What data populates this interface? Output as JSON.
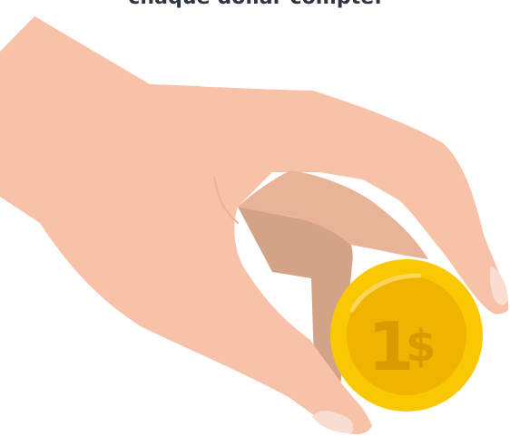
{
  "caption": {
    "text": "chaque dollar compte."
  },
  "coin": {
    "label_one": "1",
    "label_currency": "$"
  },
  "colors": {
    "skin": "#F7C2A8",
    "skin_shadow": "#E8B497",
    "skin_dark": "#D3A387",
    "nail": "#F9DDD2",
    "coin_outer": "#FAC800",
    "coin_inner": "#F0B400",
    "coin_text": "#D99A00",
    "text": "#2F3441"
  },
  "icons": {
    "hand": "hand-icon",
    "coin": "dollar-coin-icon"
  }
}
